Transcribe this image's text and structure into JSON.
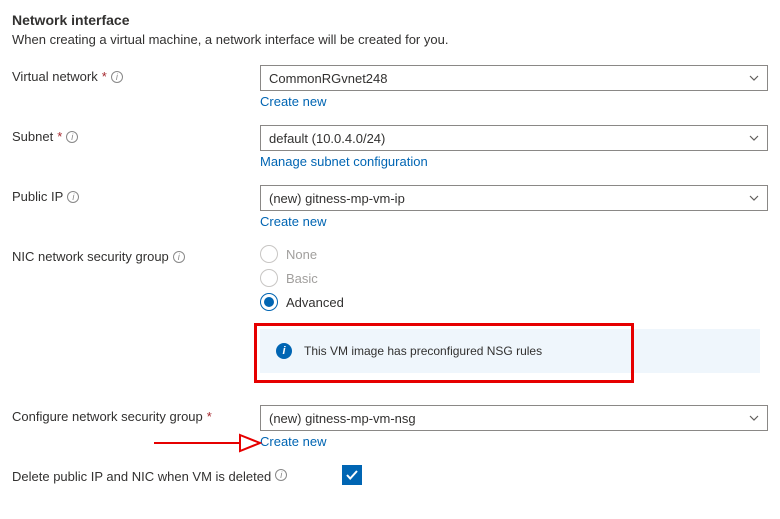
{
  "header": {
    "title": "Network interface",
    "description": "When creating a virtual machine, a network interface will be created for you."
  },
  "fields": {
    "virtual_network": {
      "label": "Virtual network",
      "value": "CommonRGvnet248",
      "link": "Create new"
    },
    "subnet": {
      "label": "Subnet",
      "value": "default (10.0.4.0/24)",
      "link": "Manage subnet configuration"
    },
    "public_ip": {
      "label": "Public IP",
      "value": "(new) gitness-mp-vm-ip",
      "link": "Create new"
    },
    "nsg_radio": {
      "label": "NIC network security group",
      "options": {
        "none": "None",
        "basic": "Basic",
        "advanced": "Advanced"
      },
      "selected": "advanced"
    },
    "nsg_select": {
      "label": "Configure network security group",
      "value": "(new) gitness-mp-vm-nsg",
      "link": "Create new"
    },
    "delete_on_vm_delete": {
      "label": "Delete public IP and NIC when VM is deleted",
      "checked": true
    }
  },
  "banner": {
    "text": "This VM image has preconfigured NSG rules"
  }
}
